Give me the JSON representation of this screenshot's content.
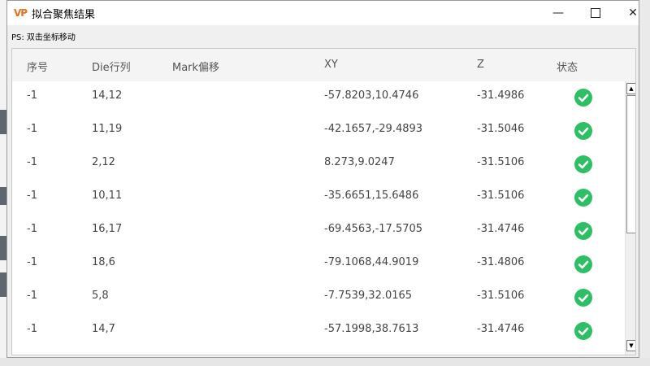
{
  "window": {
    "logo_text": "VP",
    "title": "拟合聚焦结果",
    "minimize_symbol": "—",
    "close_symbol": "✕"
  },
  "note": "PS: 双击坐标移动",
  "table": {
    "headers": [
      "序号",
      "Die行列",
      "Mark偏移",
      "XY",
      "Z",
      "状态"
    ],
    "rows": [
      {
        "index": "-1",
        "die": "14,12",
        "mark": "",
        "xy": "-57.8203,10.4746",
        "z": "-31.4986",
        "status": "ok"
      },
      {
        "index": "-1",
        "die": "11,19",
        "mark": "",
        "xy": "-42.1657,-29.4893",
        "z": "-31.5046",
        "status": "ok"
      },
      {
        "index": "-1",
        "die": "2,12",
        "mark": "",
        "xy": "8.273,9.0247",
        "z": "-31.5106",
        "status": "ok"
      },
      {
        "index": "-1",
        "die": "10,11",
        "mark": "",
        "xy": "-35.6651,15.6486",
        "z": "-31.5106",
        "status": "ok"
      },
      {
        "index": "-1",
        "die": "16,17",
        "mark": "",
        "xy": "-69.4563,-17.5705",
        "z": "-31.4746",
        "status": "ok"
      },
      {
        "index": "-1",
        "die": "18,6",
        "mark": "",
        "xy": "-79.1068,44.9019",
        "z": "-31.4806",
        "status": "ok"
      },
      {
        "index": "-1",
        "die": "5,8",
        "mark": "",
        "xy": "-7.7539,32.0165",
        "z": "-31.5106",
        "status": "ok"
      },
      {
        "index": "-1",
        "die": "14,7",
        "mark": "",
        "xy": "-57.1998,38.7613",
        "z": "-31.4746",
        "status": "ok"
      }
    ]
  },
  "colors": {
    "status_ok": "#2dbf63",
    "logo": "#e8731c"
  },
  "icons": {
    "status": "check-circle-icon",
    "scroll_up": "arrow-up-icon",
    "scroll_down": "arrow-down-icon"
  }
}
